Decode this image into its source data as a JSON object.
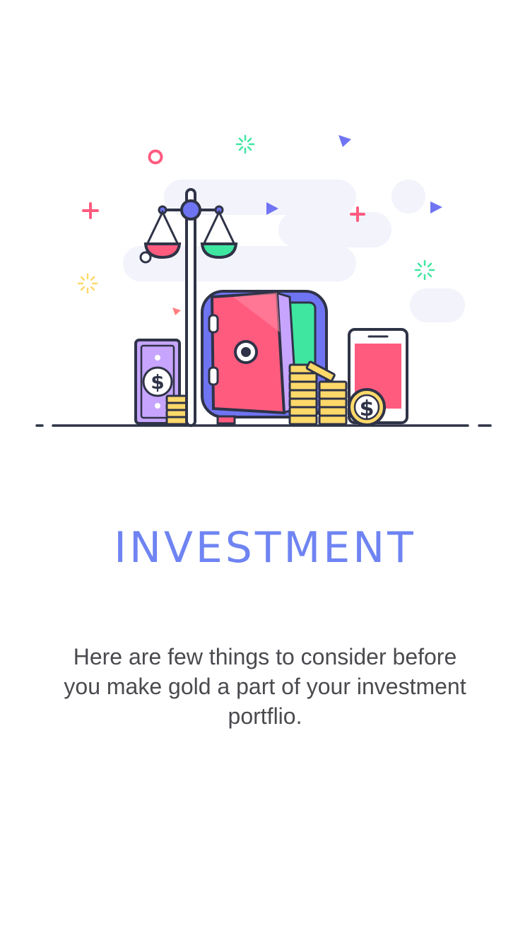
{
  "screen": {
    "title": "INVESTMENT",
    "description": "Here are few things to consider before you make gold a part of your investment portflio."
  },
  "illustration": {
    "icons": [
      "scale-icon",
      "safe-icon",
      "banknote-icon",
      "coin-stack-icon",
      "dollar-coin-icon",
      "phone-icon"
    ],
    "colors": {
      "outline": "#2f3347",
      "accent_blue": "#6f84f2",
      "red": "#ff5b7f",
      "green": "#3ee6a0",
      "gold": "#fed96a",
      "purple": "#c7a5ff",
      "cloud": "#f2f3fb"
    }
  }
}
